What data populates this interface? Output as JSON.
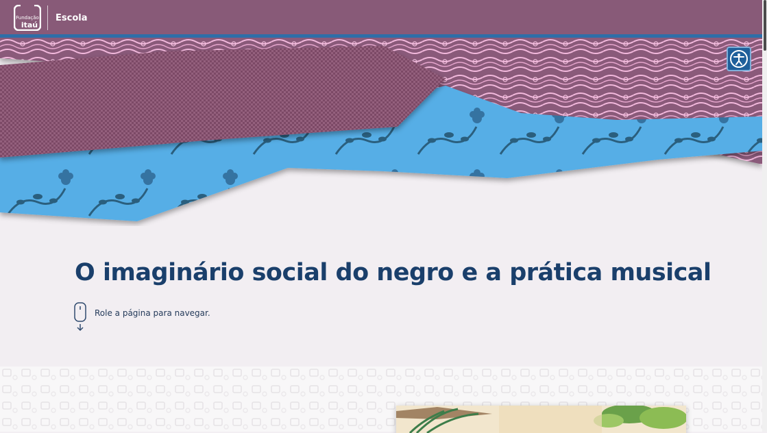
{
  "header": {
    "logo_line1": "Fundação",
    "logo_line2": "itaú",
    "section": "Escola"
  },
  "hero": {
    "title": "O imaginário social do negro e a prática musical",
    "scroll_hint": "Role a página para navegar."
  },
  "icons": {
    "accessibility": "accessibility-icon",
    "mouse": "mouse-scroll-icon",
    "arrow": "arrow-down-icon"
  },
  "colors": {
    "header_bg": "#885a78",
    "header_border": "#2e6ea8",
    "title": "#1a3f6b",
    "page_bg": "#f2eef2",
    "accessibility_bg": "#1f5f9a"
  }
}
